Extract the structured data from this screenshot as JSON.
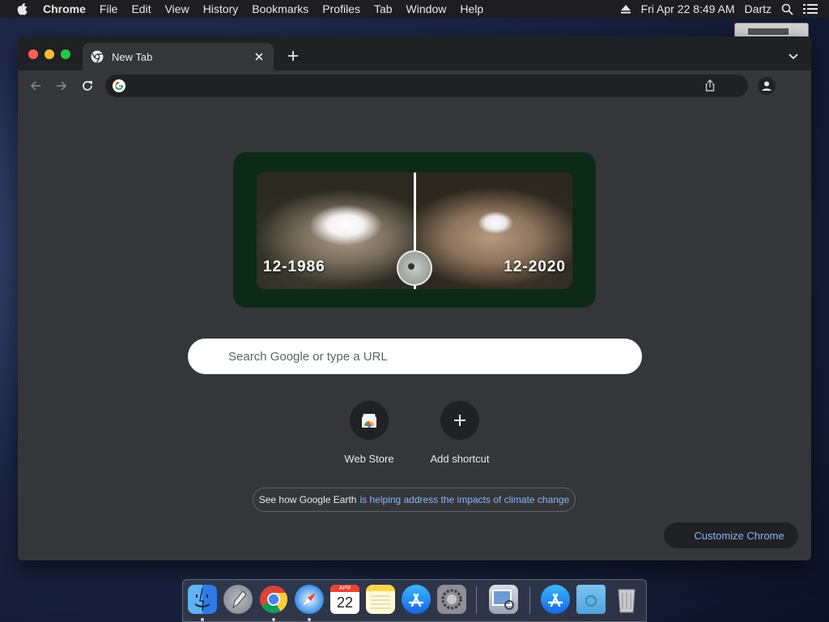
{
  "menubar": {
    "app_name": "Chrome",
    "menus": [
      "File",
      "Edit",
      "View",
      "History",
      "Bookmarks",
      "Profiles",
      "Tab",
      "Window",
      "Help"
    ],
    "datetime": "Fri Apr 22  8:49 AM",
    "user": "Dartz"
  },
  "browser": {
    "tab_title": "New Tab",
    "omnibox_value": ""
  },
  "doodle": {
    "date_left": "12-1986",
    "date_right": "12-2020"
  },
  "search": {
    "placeholder": "Search Google or type a URL"
  },
  "shortcuts": [
    {
      "label": "Web Store",
      "icon": "web-store-icon"
    },
    {
      "label": "Add shortcut",
      "icon": "plus-icon"
    }
  ],
  "promo": {
    "text": "See how Google Earth",
    "link": "is helping address the impacts of climate change"
  },
  "customize_label": "Customize Chrome",
  "dock": {
    "apps": [
      "finder",
      "launchpad",
      "chrome",
      "safari",
      "calendar",
      "notes",
      "app-store",
      "system-preferences",
      "preview",
      "applications-folder",
      "downloads-folder",
      "trash"
    ],
    "calendar_month": "APR",
    "calendar_day": "22"
  },
  "colors": {
    "window_bg": "#35363a",
    "tabstrip_bg": "#202124",
    "link": "#8ab4f8",
    "doodle_frame": "#0d2a16"
  }
}
